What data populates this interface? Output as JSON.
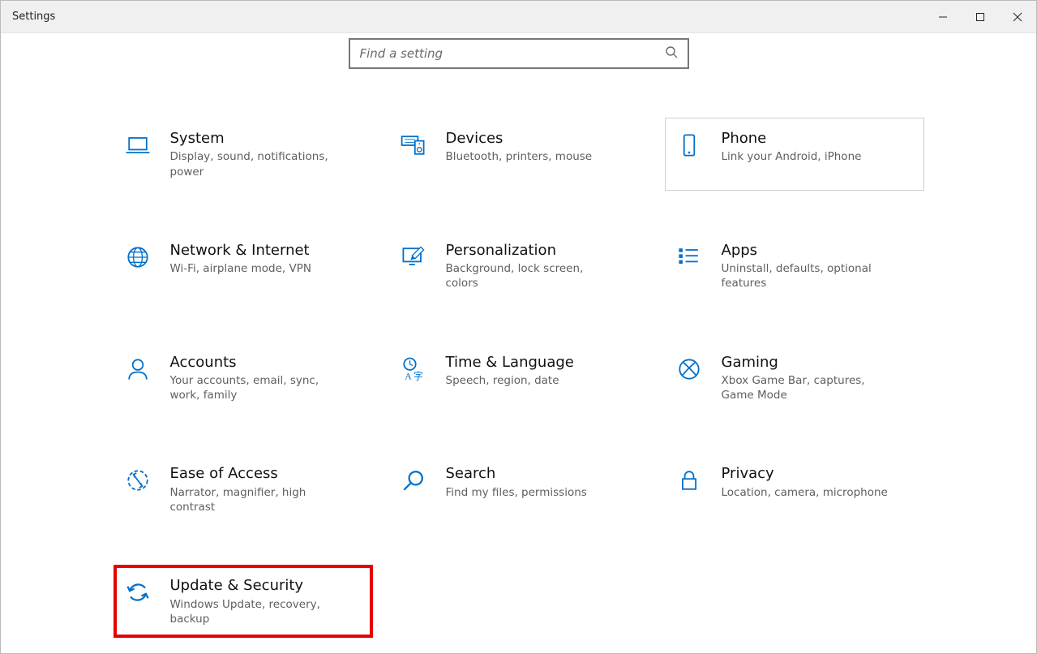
{
  "window": {
    "title": "Settings"
  },
  "search": {
    "placeholder": "Find a setting"
  },
  "categories": [
    {
      "key": "system",
      "title": "System",
      "desc": "Display, sound, notifications, power"
    },
    {
      "key": "devices",
      "title": "Devices",
      "desc": "Bluetooth, printers, mouse"
    },
    {
      "key": "phone",
      "title": "Phone",
      "desc": "Link your Android, iPhone"
    },
    {
      "key": "network",
      "title": "Network & Internet",
      "desc": "Wi-Fi, airplane mode, VPN"
    },
    {
      "key": "personalization",
      "title": "Personalization",
      "desc": "Background, lock screen, colors"
    },
    {
      "key": "apps",
      "title": "Apps",
      "desc": "Uninstall, defaults, optional features"
    },
    {
      "key": "accounts",
      "title": "Accounts",
      "desc": "Your accounts, email, sync, work, family"
    },
    {
      "key": "time",
      "title": "Time & Language",
      "desc": "Speech, region, date"
    },
    {
      "key": "gaming",
      "title": "Gaming",
      "desc": "Xbox Game Bar, captures, Game Mode"
    },
    {
      "key": "ease",
      "title": "Ease of Access",
      "desc": "Narrator, magnifier, high contrast"
    },
    {
      "key": "search_cat",
      "title": "Search",
      "desc": "Find my files, permissions"
    },
    {
      "key": "privacy",
      "title": "Privacy",
      "desc": "Location, camera, microphone"
    },
    {
      "key": "update",
      "title": "Update & Security",
      "desc": "Windows Update, recovery, backup"
    }
  ]
}
